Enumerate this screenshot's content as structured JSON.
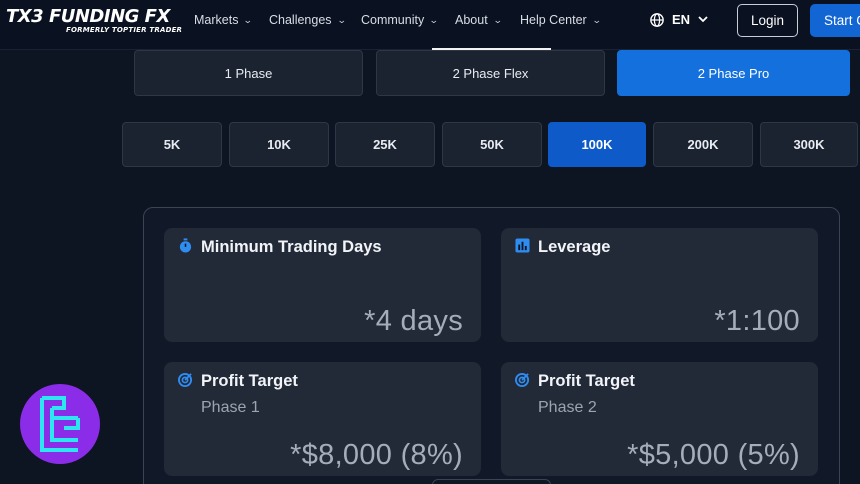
{
  "brand": {
    "name": "TX3 FUNDING FX",
    "tagline": "FORMERLY TOPTIER TRADER"
  },
  "nav": {
    "items": [
      {
        "label": "Markets"
      },
      {
        "label": "Challenges"
      },
      {
        "label": "Community"
      },
      {
        "label": "About"
      },
      {
        "label": "Help Center"
      }
    ],
    "language": "EN",
    "login_label": "Login",
    "start_label": "Start C"
  },
  "phases": [
    {
      "label": "1 Phase",
      "active": false
    },
    {
      "label": "2 Phase Flex",
      "active": false
    },
    {
      "label": "2 Phase Pro",
      "active": true
    }
  ],
  "sizes": [
    {
      "label": "5K",
      "active": false
    },
    {
      "label": "10K",
      "active": false
    },
    {
      "label": "25K",
      "active": false
    },
    {
      "label": "50K",
      "active": false
    },
    {
      "label": "100K",
      "active": true
    },
    {
      "label": "200K",
      "active": false
    },
    {
      "label": "300K",
      "active": false
    }
  ],
  "cards": {
    "min_days": {
      "title": "Minimum Trading Days",
      "value": "*4 days",
      "icon": "stopwatch-icon"
    },
    "leverage": {
      "title": "Leverage",
      "value": "*1:100",
      "icon": "bar-chart-icon"
    },
    "profit1": {
      "title": "Profit Target",
      "subtitle": "Phase 1",
      "value": "*$8,000 (8%)",
      "icon": "target-icon"
    },
    "profit2": {
      "title": "Profit Target",
      "subtitle": "Phase 2",
      "value": "*$5,000 (5%)",
      "icon": "target-icon"
    }
  },
  "colors": {
    "accent": "#1370dd",
    "active_size": "#0e5ac8",
    "background": "#0d1422",
    "card": "#222a38",
    "badge": "#8b2ce8",
    "badge_glyph": "#2ee6f0"
  }
}
